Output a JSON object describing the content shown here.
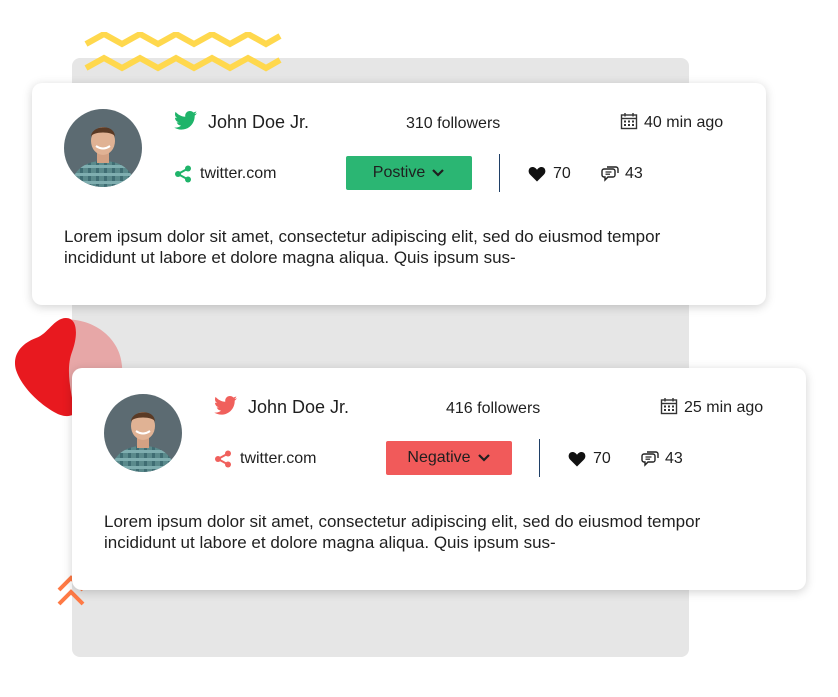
{
  "colors": {
    "positive": "#2bb673",
    "negative": "#f15a5a",
    "twitter_positive": "#1fb46a",
    "twitter_negative": "#f0605c",
    "panel": "#e6e6e6",
    "zigzag": "#ffd84d",
    "blob_red": "#e8191f",
    "blob_pink": "#e7a7a7",
    "chevron": "#ff7a45"
  },
  "icons": {
    "source": "twitter-bird-icon",
    "date": "calendar-icon",
    "link": "share-icon",
    "likes": "heart-icon",
    "comments": "comment-bubbles-icon",
    "dropdown": "chevron-down-icon"
  },
  "posts": [
    {
      "author": "John Doe Jr.",
      "followers": "310 followers",
      "time": "40 min ago",
      "source": "twitter.com",
      "sentiment": "Postive",
      "sentiment_color": "#2bb673",
      "icon_color": "#1fb46a",
      "likes": "70",
      "comments": "43",
      "text": "Lorem ipsum dolor sit amet, consectetur adipiscing elit, sed do eiusmod tempor incididunt ut labore et dolore magna aliqua. Quis ipsum sus-"
    },
    {
      "author": "John Doe Jr.",
      "followers": "416 followers",
      "time": "25 min ago",
      "source": "twitter.com",
      "sentiment": "Negative",
      "sentiment_color": "#f15a5a",
      "icon_color": "#f0605c",
      "likes": "70",
      "comments": "43",
      "text": "Lorem ipsum dolor sit amet, consectetur adipiscing elit, sed do eiusmod tempor incididunt ut labore et dolore magna aliqua. Quis ipsum sus-"
    }
  ]
}
